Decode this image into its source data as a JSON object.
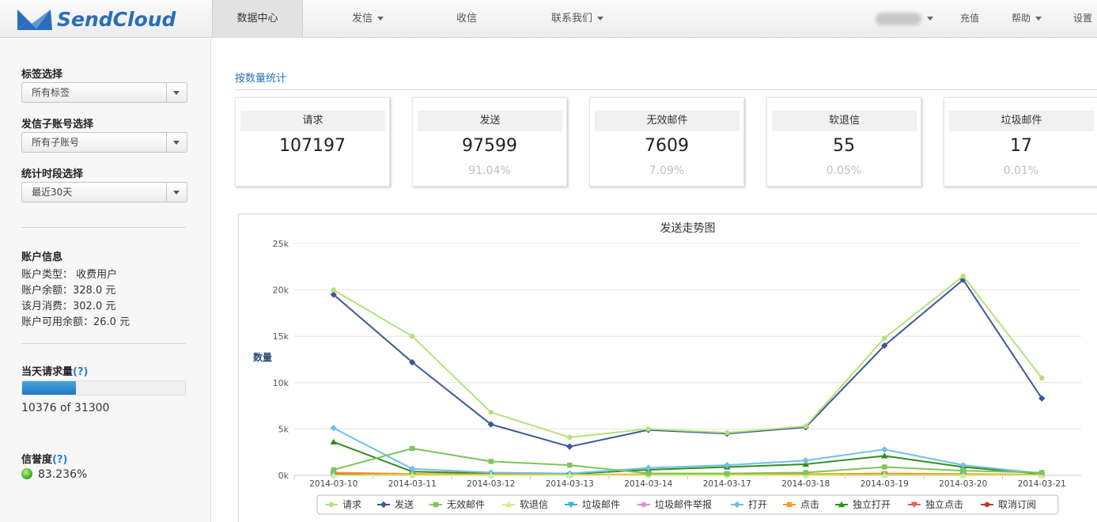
{
  "app": {
    "brand": "SendCloud"
  },
  "nav": {
    "items": [
      {
        "label": "数据中心",
        "has_caret": false,
        "active": true
      },
      {
        "label": "发信",
        "has_caret": true,
        "active": false
      },
      {
        "label": "收信",
        "has_caret": false,
        "active": false
      },
      {
        "label": "联系我们",
        "has_caret": true,
        "active": false
      }
    ],
    "right": {
      "recharge": "充值",
      "help": "帮助",
      "settings": "设置"
    }
  },
  "sidebar": {
    "tag_label": "标签选择",
    "tag_value": "所有标签",
    "subaccount_label": "发信子账号选择",
    "subaccount_value": "所有子账号",
    "period_label": "统计时段选择",
    "period_value": "最近30天",
    "account_title": "账户信息",
    "account_lines": [
      "账户类型： 收费用户",
      "账户余额：328.0 元",
      "该月消费：302.0 元",
      "账户可用余额：26.0 元"
    ],
    "daily_label": "当天请求量",
    "help_mark": "(?)",
    "daily_progress": {
      "used": 10376,
      "total": 31300,
      "text": "10376 of 31300"
    },
    "reputation_label": "信誉度",
    "reputation_value": "83.236%"
  },
  "main": {
    "section_title": "按数量统计",
    "stats": [
      {
        "label": "请求",
        "value": "107197",
        "pct": ""
      },
      {
        "label": "发送",
        "value": "97599",
        "pct": "91.04%"
      },
      {
        "label": "无效邮件",
        "value": "7609",
        "pct": "7.09%"
      },
      {
        "label": "软退信",
        "value": "55",
        "pct": "0.05%"
      },
      {
        "label": "垃圾邮件",
        "value": "17",
        "pct": "0.01%"
      }
    ]
  },
  "colors": {
    "accent": "#2a73b8",
    "请求": "#b4e27a",
    "发送": "#3b5998",
    "无效邮件": "#7cc55a",
    "软退信": "#d6ee8e",
    "垃圾邮件": "#2eb3e6",
    "垃圾邮件举报": "#e58ad0",
    "打开": "#6ec0ec",
    "点击": "#f29c1f",
    "独立打开": "#2f8f1d",
    "独立点击": "#ee5a50",
    "取消订阅": "#c0392b"
  },
  "chart_data": {
    "type": "line",
    "title": "发送走势图",
    "ylabel": "数量",
    "xlabel": "",
    "ylim": [
      0,
      25000
    ],
    "yticks": [
      0,
      5000,
      10000,
      15000,
      20000,
      25000
    ],
    "ytick_labels": [
      "0k",
      "5k",
      "10k",
      "15k",
      "20k",
      "25k"
    ],
    "grid": true,
    "legend": "bottom",
    "categories": [
      "2014-03-10",
      "2014-03-11",
      "2014-03-12",
      "2014-03-13",
      "2014-03-14",
      "2014-03-17",
      "2014-03-18",
      "2014-03-19",
      "2014-03-20",
      "2014-03-21"
    ],
    "series": [
      {
        "name": "请求",
        "marker": "circle",
        "values": [
          20000,
          15000,
          6800,
          4100,
          5000,
          4600,
          5300,
          14800,
          21500,
          10500
        ]
      },
      {
        "name": "发送",
        "marker": "diamond",
        "values": [
          19500,
          12200,
          5500,
          3100,
          4900,
          4500,
          5200,
          14000,
          21100,
          8300
        ]
      },
      {
        "name": "无效邮件",
        "marker": "square",
        "values": [
          600,
          2900,
          1500,
          1100,
          200,
          200,
          300,
          900,
          500,
          300
        ]
      },
      {
        "name": "软退信",
        "marker": "triangle",
        "values": [
          10,
          5,
          5,
          3,
          5,
          3,
          4,
          10,
          8,
          2
        ]
      },
      {
        "name": "垃圾邮件",
        "marker": "tri-down",
        "values": [
          3,
          2,
          2,
          1,
          2,
          1,
          1,
          2,
          2,
          1
        ]
      },
      {
        "name": "垃圾邮件举报",
        "marker": "circle",
        "values": [
          0,
          0,
          0,
          0,
          0,
          0,
          0,
          0,
          0,
          0
        ]
      },
      {
        "name": "打开",
        "marker": "diamond",
        "values": [
          5100,
          700,
          300,
          200,
          800,
          1100,
          1600,
          2800,
          1100,
          200
        ]
      },
      {
        "name": "点击",
        "marker": "square",
        "values": [
          300,
          150,
          120,
          80,
          100,
          120,
          130,
          200,
          150,
          60
        ]
      },
      {
        "name": "独立打开",
        "marker": "triangle",
        "values": [
          3600,
          400,
          200,
          150,
          600,
          900,
          1200,
          2100,
          900,
          150
        ]
      },
      {
        "name": "独立点击",
        "marker": "tri-down",
        "values": [
          200,
          100,
          80,
          60,
          80,
          90,
          100,
          150,
          120,
          40
        ]
      },
      {
        "name": "取消订阅",
        "marker": "circle",
        "values": [
          100,
          60,
          40,
          30,
          40,
          50,
          60,
          80,
          60,
          20
        ]
      }
    ]
  }
}
